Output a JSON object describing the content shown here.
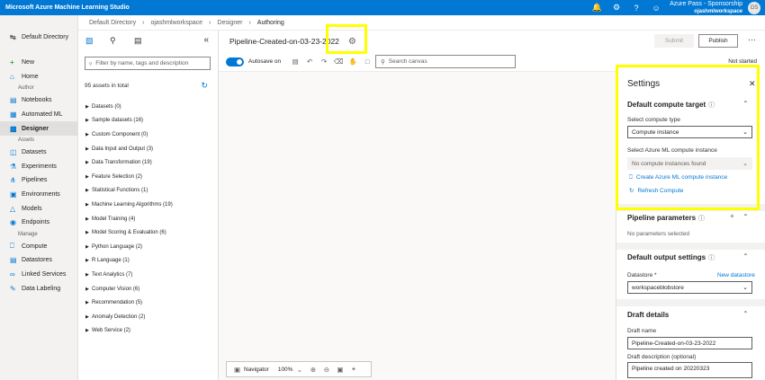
{
  "topbar": {
    "title": "Microsoft Azure Machine Learning Studio",
    "account_name": "Azure Pass - Sponsorship",
    "account_sub": "ojashmlworkspace",
    "avatar": "OS",
    "icons": [
      "bell-icon",
      "gear-icon",
      "help-icon",
      "smiley-icon"
    ]
  },
  "leftnav": {
    "default_directory": "Default Directory",
    "items_top": [
      {
        "label": "New",
        "icon": "plus-icon"
      },
      {
        "label": "Home",
        "icon": "home-icon"
      }
    ],
    "author_label": "Author",
    "author_items": [
      {
        "label": "Notebooks",
        "icon": "notebook-icon"
      },
      {
        "label": "Automated ML",
        "icon": "automl-icon"
      },
      {
        "label": "Designer",
        "icon": "designer-icon"
      }
    ],
    "assets_label": "Assets",
    "assets_items": [
      {
        "label": "Datasets",
        "icon": "datasets-icon"
      },
      {
        "label": "Experiments",
        "icon": "experiments-icon"
      },
      {
        "label": "Pipelines",
        "icon": "pipelines-icon"
      },
      {
        "label": "Environments",
        "icon": "environments-icon"
      },
      {
        "label": "Models",
        "icon": "models-icon"
      },
      {
        "label": "Endpoints",
        "icon": "endpoints-icon"
      }
    ],
    "manage_label": "Manage",
    "manage_items": [
      {
        "label": "Compute",
        "icon": "compute-icon"
      },
      {
        "label": "Datastores",
        "icon": "datastores-icon"
      },
      {
        "label": "Linked Services",
        "icon": "linked-services-icon"
      },
      {
        "label": "Data Labeling",
        "icon": "data-labeling-icon"
      }
    ]
  },
  "breadcrumb": [
    "Default Directory",
    "ojashmlworkspace",
    "Designer",
    "Authoring"
  ],
  "assets": {
    "search_placeholder": "Filter by name, tags and description",
    "count": "95 assets in total",
    "items": [
      "Datasets (0)",
      "Sample datasets (16)",
      "Custom Component (0)",
      "Data Input and Output (3)",
      "Data Transformation (19)",
      "Feature Selection (2)",
      "Statistical Functions (1)",
      "Machine Learning Algorithms (19)",
      "Model Training (4)",
      "Model Scoring & Evaluation (6)",
      "Python Language (2)",
      "R Language (1)",
      "Text Analytics (7)",
      "Computer Vision (6)",
      "Recommendation (5)",
      "Anomaly Detection (2)",
      "Web Service (2)"
    ]
  },
  "toolbar": {
    "pipeline_name": "Pipeline-Created-on-03-23-2022",
    "submit": "Submit",
    "publish": "Publish",
    "autosave": "Autosave on",
    "search_canvas": "Search canvas",
    "status": "Not started"
  },
  "navigator": {
    "label": "Navigator",
    "zoom": "100%"
  },
  "settings": {
    "title": "Settings",
    "compute_target_heading": "Default compute target",
    "compute_type_label": "Select compute type",
    "compute_type_value": "Compute instance",
    "aml_instance_label": "Select Azure ML compute instance",
    "aml_instance_value": "No compute instances found",
    "create_link": "Create Azure ML compute instance",
    "refresh_link": "Refresh Compute",
    "pipeline_params_heading": "Pipeline parameters",
    "no_params": "No parameters selected",
    "output_heading": "Default output settings",
    "datastore_label": "Datastore *",
    "new_datastore": "New datastore",
    "datastore_value": "workspaceblobstore",
    "draft_heading": "Draft details",
    "draft_name_label": "Draft name",
    "draft_name_value": "Pipeline-Created-on-03-23-2022",
    "draft_desc_label": "Draft description (optional)",
    "draft_desc_value": "Pipeline created on 20220323"
  }
}
